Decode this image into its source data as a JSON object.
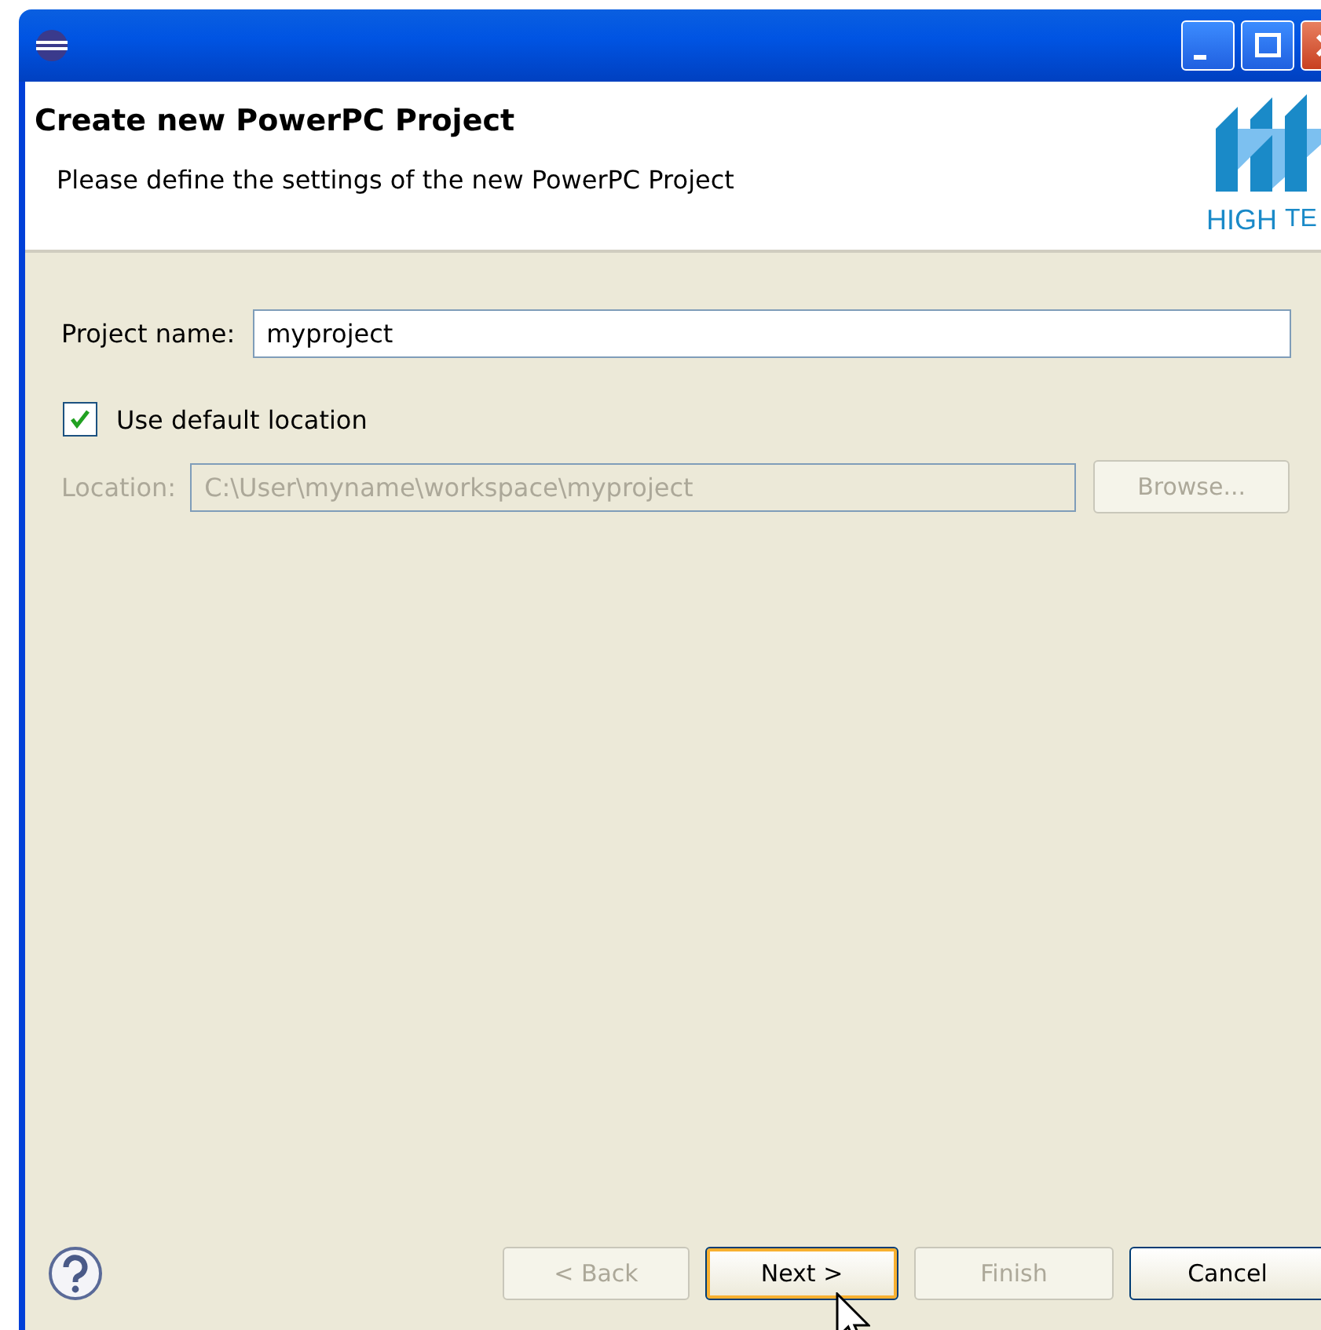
{
  "header": {
    "title": "Create new PowerPC Project",
    "description": "Please define the settings of the new PowerPC Project",
    "logo_texts": [
      "HIGH",
      "TE"
    ]
  },
  "form": {
    "project_name": {
      "label": "Project name:",
      "value": "myproject"
    },
    "use_default_location": {
      "label": "Use default location",
      "checked": true
    },
    "location": {
      "label": "Location:",
      "value": "C:\\User\\myname\\workspace\\myproject",
      "disabled": true
    },
    "browse_button": {
      "label": "Browse...",
      "disabled": true
    }
  },
  "buttons": [
    {
      "label": "< Back",
      "disabled": true,
      "focused": false
    },
    {
      "label": "Next >",
      "disabled": false,
      "focused": true
    },
    {
      "label": "Finish",
      "disabled": true,
      "focused": false
    },
    {
      "label": "Cancel",
      "disabled": false,
      "focused": false
    }
  ]
}
